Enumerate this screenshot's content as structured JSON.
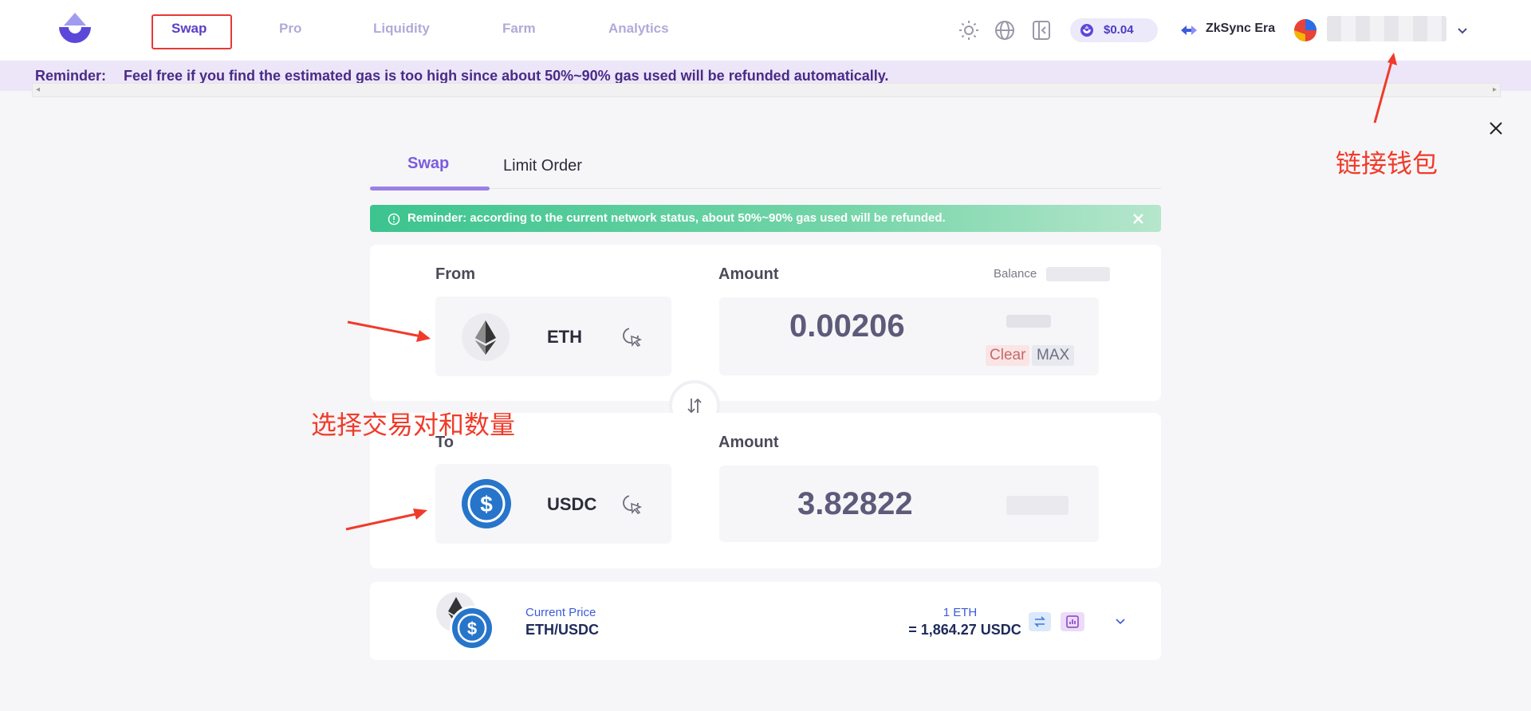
{
  "nav": {
    "items": [
      {
        "label": "Swap",
        "active": true
      },
      {
        "label": "Pro",
        "active": false
      },
      {
        "label": "Liquidity",
        "active": false
      },
      {
        "label": "Farm",
        "active": false
      },
      {
        "label": "Analytics",
        "active": false
      }
    ],
    "token_price": "$0.04",
    "network": "ZkSync Era"
  },
  "reminder_bar": {
    "label": "Reminder:",
    "text": "Feel free if you find the estimated gas is too high since about 50%~90% gas used will be refunded automatically."
  },
  "tabs": [
    {
      "label": "Swap",
      "active": true
    },
    {
      "label": "Limit Order",
      "active": false
    }
  ],
  "alert": {
    "text": "Reminder: according to the current network status, about 50%~90% gas used will be refunded."
  },
  "from": {
    "label": "From",
    "token": "ETH",
    "amount_label": "Amount",
    "balance_label": "Balance",
    "amount": "0.00206",
    "clear_label": "Clear",
    "max_label": "MAX"
  },
  "to": {
    "label": "To",
    "token": "USDC",
    "amount_label": "Amount",
    "amount": "3.82822"
  },
  "price": {
    "label": "Current Price",
    "pair": "ETH/USDC",
    "rate_line1": "1 ETH",
    "rate_line2": "= 1,864.27 USDC"
  },
  "annotations": {
    "wallet": "链接钱包",
    "select_pair": "选择交易对和数量"
  },
  "colors": {
    "accent": "#5a3fc8",
    "alert_start": "#3cc48f",
    "annotation": "#f03b2a",
    "usdc": "#2775ca"
  }
}
